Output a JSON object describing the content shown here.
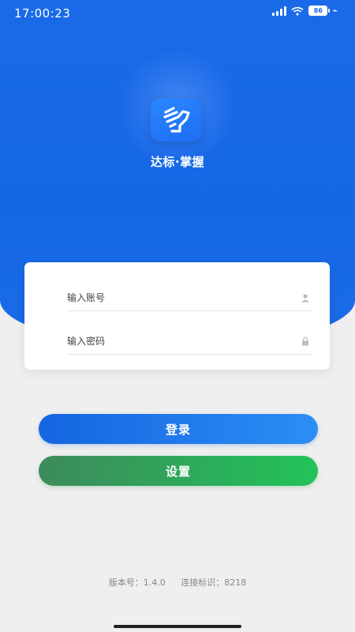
{
  "status_bar": {
    "time": "17:00:23",
    "battery": "86",
    "icons": [
      "signal-icon",
      "wifi-icon",
      "battery-icon"
    ]
  },
  "app": {
    "name": "达标·掌握",
    "logo_icon": "fist-logo-icon",
    "brand_color": "#1a6ae8"
  },
  "form": {
    "account_placeholder": "输入账号",
    "account_value": "",
    "account_icon": "user-icon",
    "password_placeholder": "输入密码",
    "password_value": "",
    "password_icon": "lock-icon"
  },
  "buttons": {
    "login_label": "登录",
    "settings_label": "设置"
  },
  "footer": {
    "version": "版本号：1.4.0",
    "connection_id": "连接标识：8218"
  }
}
